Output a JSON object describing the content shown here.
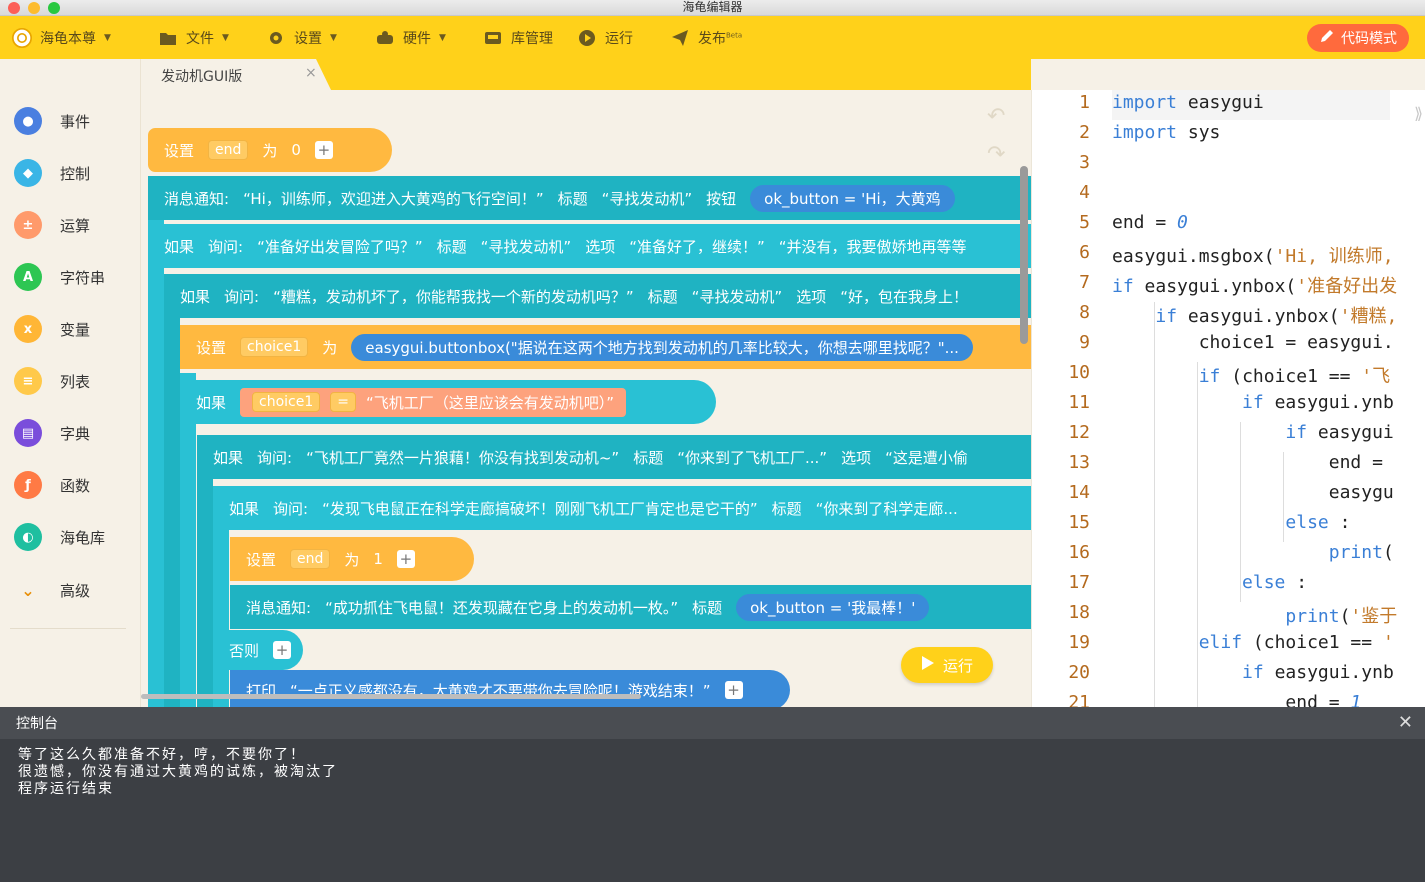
{
  "window_title": "海龟编辑器",
  "toolbar": {
    "brand": "海龟本尊",
    "menu": [
      {
        "label": "文件",
        "icon": "folder-icon"
      },
      {
        "label": "设置",
        "icon": "gear-icon"
      },
      {
        "label": "硬件",
        "icon": "hardware-icon"
      },
      {
        "label": "库管理",
        "icon": "library-icon"
      },
      {
        "label": "运行",
        "icon": "play-icon"
      },
      {
        "label": "发布",
        "icon": "send-icon",
        "badge": "Beta"
      }
    ],
    "code_mode": "代码模式"
  },
  "tab": {
    "label": "发动机GUI版",
    "close": "×"
  },
  "sidebar": {
    "items": [
      {
        "label": "事件",
        "color": "#4a7fe0"
      },
      {
        "label": "控制",
        "color": "#3ab5e6"
      },
      {
        "label": "运算",
        "color": "#ff9a6b"
      },
      {
        "label": "字符串",
        "color": "#2dc653"
      },
      {
        "label": "变量",
        "color": "#ffb636"
      },
      {
        "label": "列表",
        "color": "#ffc94a"
      },
      {
        "label": "字典",
        "color": "#7a4ddb"
      },
      {
        "label": "函数",
        "color": "#ff7a45"
      },
      {
        "label": "海龟库",
        "color": "#1fbfa0"
      }
    ],
    "advanced": "高级"
  },
  "blocks": {
    "set_end": {
      "k1": "设置",
      "var": "end",
      "k2": "为",
      "val": "0"
    },
    "msgbox": {
      "k": "消息通知:",
      "text": "“Hi，训练师，欢迎进入大黄鸡的飞行空间！”",
      "title_k": "标题",
      "title": "“寻找发动机”",
      "btn_k": "按钮",
      "btn": "ok_button = 'Hi，大黄鸡"
    },
    "if1": {
      "k": "如果",
      "ask": "询问:",
      "text": "“准备好出发冒险了吗？”",
      "title_k": "标题",
      "title": "“寻找发动机”",
      "opt_k": "选项",
      "opt1": "“准备好了，继续！”",
      "opt2": "“并没有，我要傲娇地再等等"
    },
    "if2": {
      "k": "如果",
      "ask": "询问:",
      "text": "“糟糕，发动机坏了，你能帮我找一个新的发动机吗？”",
      "title_k": "标题",
      "title": "“寻找发动机”",
      "opt_k": "选项",
      "opt1": "“好，包在我身上！"
    },
    "set_choice": {
      "k1": "设置",
      "var": "choice1",
      "k2": "为",
      "expr": "easygui.buttonbox(\"据说在这两个地方找到发动机的几率比较大，你想去哪里找呢？\"..."
    },
    "if3": {
      "k": "如果",
      "var": "choice1",
      "op": "=",
      "text": "“飞机工厂（这里应该会有发动机吧）”"
    },
    "if4": {
      "k": "如果",
      "ask": "询问:",
      "text": "“飞机工厂竟然一片狼藉！你没有找到发动机~”",
      "title_k": "标题",
      "title": "“你来到了飞机工厂...”",
      "opt_k": "选项",
      "opt1": "“这是遭小偷"
    },
    "if5": {
      "k": "如果",
      "ask": "询问:",
      "text": "“发现飞电鼠正在科学走廊搞破坏！刚刚飞机工厂肯定也是它干的”",
      "title_k": "标题",
      "title": "“你来到了科学走廊..."
    },
    "set_end2": {
      "k1": "设置",
      "var": "end",
      "k2": "为",
      "val": "1"
    },
    "msgbox2": {
      "k": "消息通知:",
      "text": "“成功抓住飞电鼠！还发现藏在它身上的发动机一枚。”",
      "title_k": "标题",
      "btn": "ok_button = '我最棒！'"
    },
    "else": "否则",
    "print": {
      "k": "打印",
      "text": "“一点正义感都没有，大黄鸡才不要带你去冒险呢！游戏结束！”"
    }
  },
  "run_button": "运行",
  "editor": {
    "lines": [
      "import easygui",
      "import sys",
      "",
      "",
      "end = 0",
      "easygui.msgbox('Hi, 训练师,",
      "if easygui.ynbox('准备好出发",
      "    if easygui.ynbox('糟糕,",
      "        choice1 = easygui.",
      "        if (choice1 == '飞",
      "            if easygui.ynb",
      "                if easygui",
      "                    end =",
      "                    easygu",
      "                else :",
      "                    print(",
      "            else :",
      "                print('鉴于",
      "        elif (choice1 == '",
      "            if easygui.ynb",
      "                end = 1"
    ]
  },
  "console": {
    "title": "控制台",
    "lines": [
      "等了这么久都准备不好，哼，不要你了！",
      "很遗憾，你没有通过大黄鸡的试炼，被淘汰了",
      "程序运行结束"
    ]
  }
}
